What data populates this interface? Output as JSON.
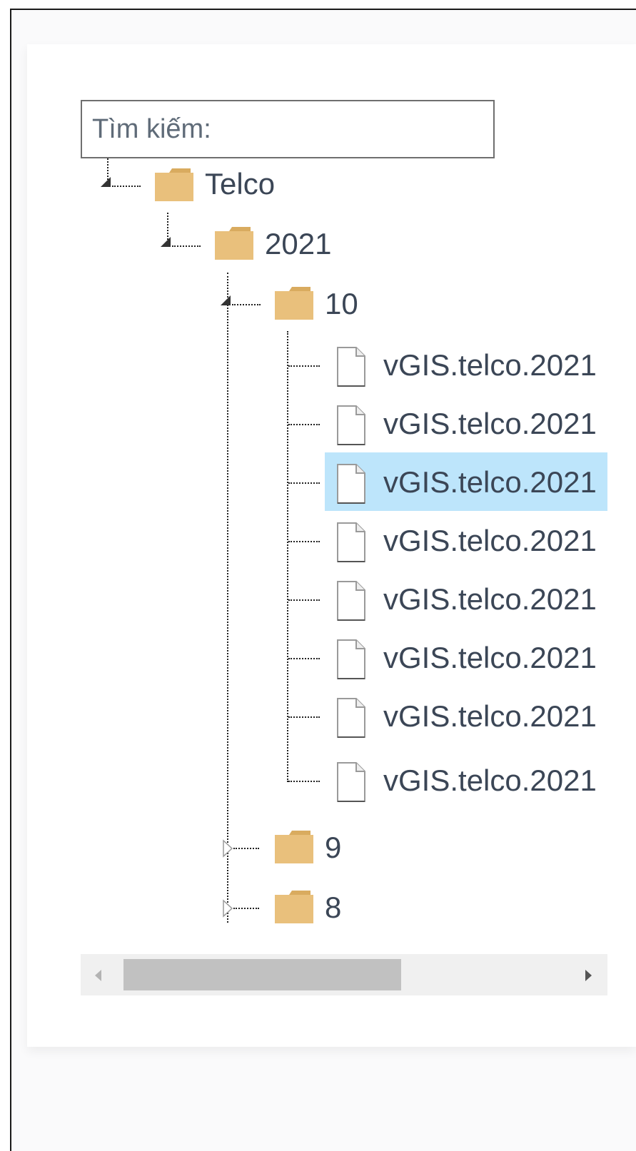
{
  "search": {
    "placeholder": "Tìm kiếm:",
    "value": ""
  },
  "tree": {
    "root": {
      "label": "Telco",
      "icon": "folder-icon",
      "expanded": true
    },
    "year": {
      "label": "2021",
      "icon": "folder-icon",
      "expanded": true
    },
    "month_open": {
      "label": "10",
      "icon": "folder-icon",
      "expanded": true
    },
    "files": [
      {
        "label": "vGIS.telco.2021",
        "icon": "file-icon",
        "selected": false
      },
      {
        "label": "vGIS.telco.2021",
        "icon": "file-icon",
        "selected": false
      },
      {
        "label": "vGIS.telco.2021",
        "icon": "file-icon",
        "selected": true
      },
      {
        "label": "vGIS.telco.2021",
        "icon": "file-icon",
        "selected": false
      },
      {
        "label": "vGIS.telco.2021",
        "icon": "file-icon",
        "selected": false
      },
      {
        "label": "vGIS.telco.2021",
        "icon": "file-icon",
        "selected": false
      },
      {
        "label": "vGIS.telco.2021",
        "icon": "file-icon",
        "selected": false
      },
      {
        "label": "vGIS.telco.2021",
        "icon": "file-icon",
        "selected": false
      }
    ],
    "month_closed": [
      {
        "label": "9",
        "icon": "folder-icon",
        "expanded": false
      },
      {
        "label": "8",
        "icon": "folder-icon",
        "expanded": false
      }
    ]
  },
  "scrollbar": {
    "thumb_fraction": 0.63
  },
  "colors": {
    "folder": "#e9c07c",
    "selection": "#bde5fb",
    "text": "#3b4656"
  }
}
